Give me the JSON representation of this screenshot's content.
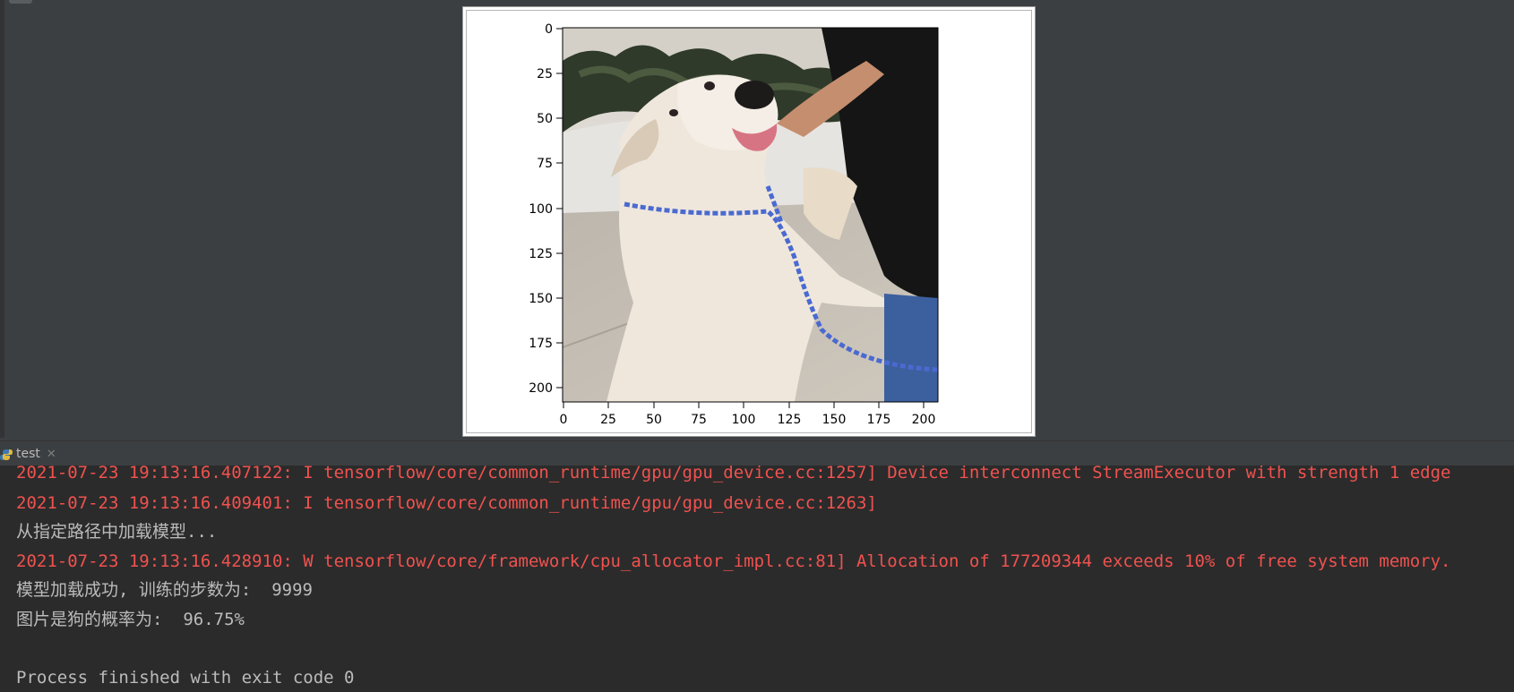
{
  "figure": {
    "y_ticks": [
      "0",
      "25",
      "50",
      "75",
      "100",
      "125",
      "150",
      "175",
      "200"
    ],
    "x_ticks": [
      "0",
      "25",
      "50",
      "75",
      "100",
      "125",
      "150",
      "175",
      "200"
    ],
    "image_content": "photo of a white dog standing up with paws against a person wearing a black shirt and jeans, blue leash around its neck"
  },
  "run_tab": {
    "label": "test",
    "icon": "python-icon"
  },
  "console": {
    "lines": [
      {
        "text": "2021-07-23 19:13:16.407122: I tensorflow/core/common_runtime/gpu/gpu_device.cc:1257] Device interconnect StreamExecutor with strength 1 edge",
        "type": "error"
      },
      {
        "text": "2021-07-23 19:13:16.409401: I tensorflow/core/common_runtime/gpu/gpu_device.cc:1263]",
        "type": "error"
      },
      {
        "text": "从指定路径中加载模型...",
        "type": "output"
      },
      {
        "text": "2021-07-23 19:13:16.428910: W tensorflow/core/framework/cpu_allocator_impl.cc:81] Allocation of 177209344 exceeds 10% of free system memory.",
        "type": "error"
      },
      {
        "text": "模型加载成功, 训练的步数为:  9999",
        "type": "output"
      },
      {
        "text": "图片是狗的概率为:  96.75%",
        "type": "output"
      },
      {
        "text": "",
        "type": "output"
      },
      {
        "text": "Process finished with exit code 0",
        "type": "output"
      }
    ]
  },
  "colors": {
    "error_text": "#f0524f",
    "output_text": "#bbbbbb",
    "console_bg": "#2b2b2b",
    "panel_bg": "#3c3f41"
  }
}
